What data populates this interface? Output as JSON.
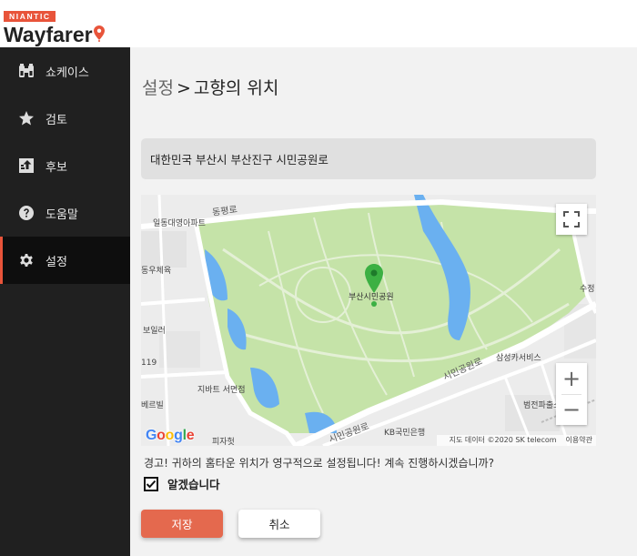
{
  "brand": {
    "tag": "NIANTIC",
    "name": "Wayfarer"
  },
  "nav": {
    "items": [
      {
        "label": "쇼케이스",
        "icon": "binoculars-icon"
      },
      {
        "label": "검토",
        "icon": "star-icon"
      },
      {
        "label": "후보",
        "icon": "upload-icon"
      },
      {
        "label": "도움말",
        "icon": "help-icon"
      },
      {
        "label": "설정",
        "icon": "gear-icon",
        "active": true
      }
    ]
  },
  "page": {
    "breadcrumb": "설정",
    "separator": ">",
    "title": "고향의 위치"
  },
  "address": {
    "value": "대한민국 부산시 부산진구 시민공원로"
  },
  "map": {
    "park_label": "부산시민공원",
    "labels": {
      "road1": "동평로",
      "apt": "일동대영아파트",
      "gym": "동우체육",
      "villa": "보일러",
      "num": "119",
      "store": "지바트 서면점",
      "hall": "베르빌",
      "pizza": "피자헛",
      "road2": "시민공원로",
      "road3": "시민공원로",
      "bank": "KB국민은행",
      "samsung": "삼성카서비스",
      "police": "범전파출소",
      "su": "수정"
    },
    "attribution": "지도 데이터 ©2020 SK telecom",
    "terms": "이용약관",
    "zoom_in": "+",
    "zoom_out": "−",
    "colors": {
      "park": "#c5e3a8",
      "water": "#6ab0f0",
      "pin": "#3cb043",
      "road": "#ffffff",
      "bg": "#ececec"
    }
  },
  "warning": "경고! 귀하의 홈타운 위치가 영구적으로 설정됩니다! 계속 진행하시겠습니까?",
  "confirm": {
    "label": "알겠습니다",
    "checked": true
  },
  "buttons": {
    "save": "저장",
    "cancel": "취소"
  },
  "colors": {
    "accent": "#e8543a",
    "sidebar": "#202020",
    "save_button": "#e4694e"
  }
}
